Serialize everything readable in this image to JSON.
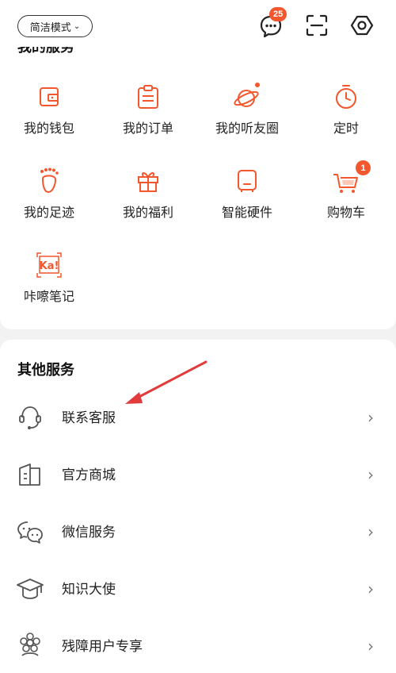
{
  "top": {
    "mode_label": "简洁模式",
    "message_badge": "25"
  },
  "my_services": {
    "title": "我的服务",
    "items": [
      {
        "label": "我的钱包",
        "icon": "wallet-icon"
      },
      {
        "label": "我的订单",
        "icon": "order-clipboard-icon"
      },
      {
        "label": "我的听友圈",
        "icon": "planet-icon"
      },
      {
        "label": "定时",
        "icon": "timer-icon"
      },
      {
        "label": "我的足迹",
        "icon": "footprint-icon"
      },
      {
        "label": "我的福利",
        "icon": "gift-icon"
      },
      {
        "label": "智能硬件",
        "icon": "smart-device-icon"
      },
      {
        "label": "购物车",
        "icon": "cart-icon",
        "badge": "1"
      },
      {
        "label": "咔嚓笔记",
        "icon": "ka-note-icon"
      }
    ]
  },
  "other_services": {
    "title": "其他服务",
    "rows": [
      {
        "label": "联系客服",
        "icon": "headset-icon"
      },
      {
        "label": "官方商城",
        "icon": "store-icon"
      },
      {
        "label": "微信服务",
        "icon": "wechat-icon"
      },
      {
        "label": "知识大使",
        "icon": "graduation-cap-icon"
      },
      {
        "label": "残障用户专享",
        "icon": "accessibility-flower-icon"
      }
    ],
    "chevron": "›"
  },
  "colors": {
    "accent": "#f2572d",
    "annotation_arrow": "#e23b3b"
  }
}
